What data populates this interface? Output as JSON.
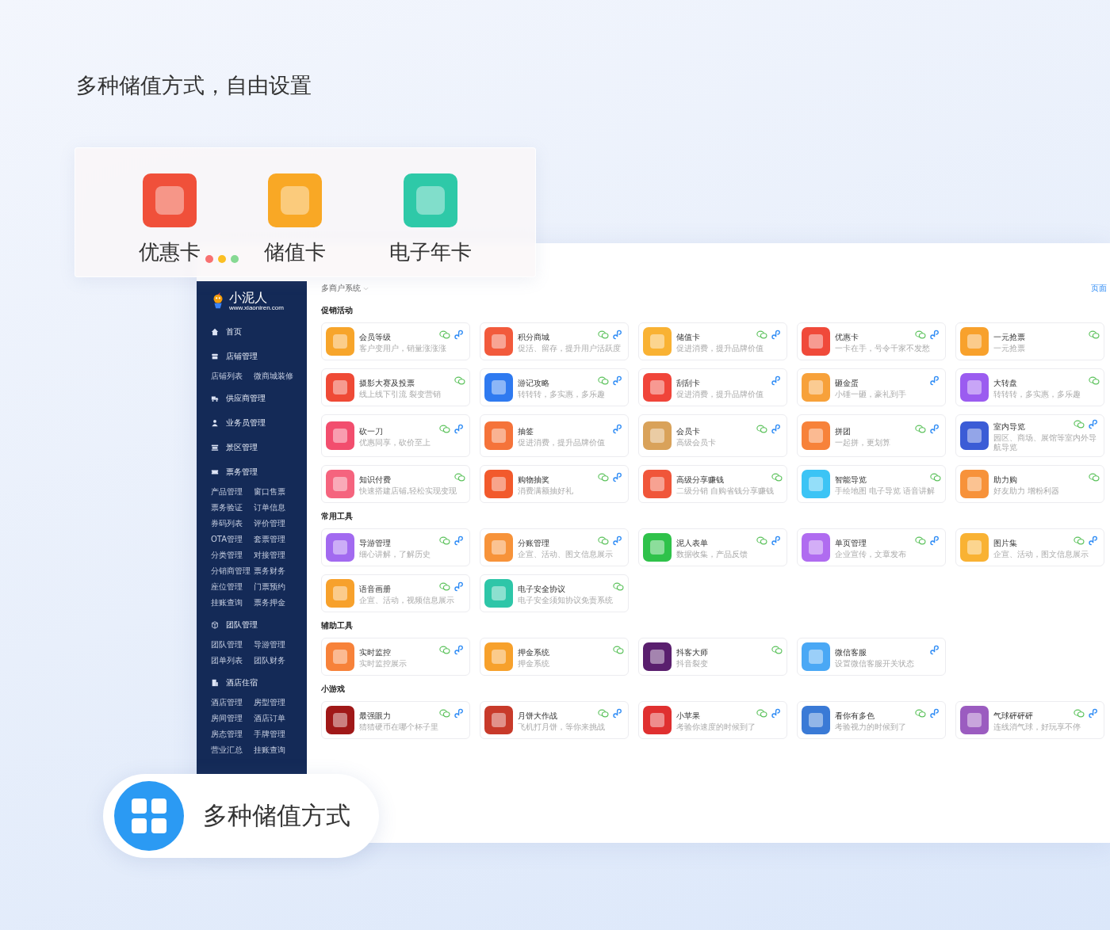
{
  "heading": "多种储值方式，自由设置",
  "feature_card": {
    "items": [
      {
        "label": "优惠卡",
        "color": "#f0503a"
      },
      {
        "label": "储值卡",
        "color": "#f9a825"
      },
      {
        "label": "电子年卡",
        "color": "#2ec9a8"
      }
    ]
  },
  "window": {
    "sidebar": {
      "logo": "小泥人",
      "logo_url": "www.xiaoniren.com",
      "items": [
        {
          "label": "首页"
        },
        {
          "label": "店铺管理",
          "children": [
            "店铺列表",
            "微商城装修"
          ]
        },
        {
          "label": "供应商管理"
        },
        {
          "label": "业务员管理"
        },
        {
          "label": "景区管理"
        },
        {
          "label": "票务管理",
          "children": [
            "产品管理",
            "窗口售票",
            "票务验证",
            "订单信息",
            "券码列表",
            "评价管理",
            "OTA管理",
            "套票管理",
            "分类管理",
            "对接管理",
            "分销商管理",
            "票务财务",
            "座位管理",
            "门票预约",
            "挂账查询",
            "票务押金"
          ]
        },
        {
          "label": "团队管理",
          "children": [
            "团队管理",
            "导游管理",
            "团单列表",
            "团队财务"
          ]
        },
        {
          "label": "酒店住宿",
          "children": [
            "酒店管理",
            "房型管理",
            "房间管理",
            "酒店订单",
            "房态管理",
            "手牌管理",
            "营业汇总",
            "挂账查询"
          ]
        }
      ]
    },
    "breadcrumb": "多商户系统",
    "top_link": "页面",
    "sections": [
      {
        "title": "促销活动",
        "items": [
          {
            "title": "会员等级",
            "desc": "客户变用户，销量涨涨涨",
            "wechat": true,
            "miniapp": true,
            "color": "#f7a52b"
          },
          {
            "title": "积分商城",
            "desc": "促活、留存，提升用户活跃度",
            "wechat": true,
            "miniapp": true,
            "color": "#f25a3c"
          },
          {
            "title": "储值卡",
            "desc": "促进消费，提升品牌价值",
            "wechat": true,
            "miniapp": true,
            "color": "#f9b233"
          },
          {
            "title": "优惠卡",
            "desc": "一卡在手，号令千家不发愁",
            "wechat": true,
            "miniapp": true,
            "color": "#f04a3a"
          },
          {
            "title": "一元抢票",
            "desc": "一元抢票",
            "wechat": true,
            "miniapp": false,
            "color": "#f8a12c"
          },
          {
            "title": "摄影大赛及投票",
            "desc": "线上线下引流 裂变营销",
            "wechat": true,
            "miniapp": false,
            "color": "#ef4a36"
          },
          {
            "title": "游记攻略",
            "desc": "转转转，多实惠，多乐趣",
            "wechat": true,
            "miniapp": true,
            "color": "#2f7af0"
          },
          {
            "title": "刮刮卡",
            "desc": "促进消费，提升品牌价值",
            "wechat": false,
            "miniapp": true,
            "color": "#f0453a"
          },
          {
            "title": "砸金蛋",
            "desc": "小锤一砸，豪礼到手",
            "wechat": false,
            "miniapp": true,
            "color": "#f7a13a"
          },
          {
            "title": "大转盘",
            "desc": "转转转，多实惠，多乐趣",
            "wechat": true,
            "miniapp": false,
            "color": "#9b5cf0"
          },
          {
            "title": "砍一刀",
            "desc": "优惠同享，砍价至上",
            "wechat": true,
            "miniapp": true,
            "color": "#f24e6e"
          },
          {
            "title": "抽签",
            "desc": "促进消费，提升品牌价值",
            "wechat": false,
            "miniapp": true,
            "color": "#f5733a"
          },
          {
            "title": "会员卡",
            "desc": "高级会员卡",
            "wechat": true,
            "miniapp": true,
            "color": "#d9a25a"
          },
          {
            "title": "拼团",
            "desc": "一起拼，更划算",
            "wechat": true,
            "miniapp": true,
            "color": "#f7823a"
          },
          {
            "title": "室内导览",
            "desc": "园区、商场、展馆等室内外导航导览",
            "wechat": true,
            "miniapp": true,
            "color": "#3b5cd6"
          },
          {
            "title": "知识付费",
            "desc": "快速搭建店铺,轻松实现变现",
            "wechat": true,
            "miniapp": false,
            "color": "#f5647e"
          },
          {
            "title": "购物抽奖",
            "desc": "消费满额抽好礼",
            "wechat": true,
            "miniapp": true,
            "color": "#f25a2c"
          },
          {
            "title": "高级分享赚钱",
            "desc": "二级分销 自购省钱分享赚钱",
            "wechat": true,
            "miniapp": false,
            "color": "#f0563a"
          },
          {
            "title": "智能导览",
            "desc": "手绘地图 电子导览 语音讲解",
            "wechat": true,
            "miniapp": false,
            "color": "#3cc4f5"
          },
          {
            "title": "助力购",
            "desc": "好友助力 增粉利器",
            "wechat": true,
            "miniapp": false,
            "color": "#f7923a"
          }
        ]
      },
      {
        "title": "常用工具",
        "items": [
          {
            "title": "导游管理",
            "desc": "细心讲解，了解历史",
            "wechat": true,
            "miniapp": true,
            "color": "#a26af0"
          },
          {
            "title": "分账管理",
            "desc": "企宣、活动、图文信息展示",
            "wechat": true,
            "miniapp": true,
            "color": "#f7933a"
          },
          {
            "title": "泥人表单",
            "desc": "数据收集，产品反馈",
            "wechat": true,
            "miniapp": true,
            "color": "#2fc24a"
          },
          {
            "title": "单页管理",
            "desc": "企业宣传，文章发布",
            "wechat": true,
            "miniapp": true,
            "color": "#b06cf0"
          },
          {
            "title": "图片集",
            "desc": "企宣、活动，图文信息展示",
            "wechat": true,
            "miniapp": true,
            "color": "#f9b233"
          },
          {
            "title": "语音画册",
            "desc": "企宣、活动，视频信息展示",
            "wechat": true,
            "miniapp": true,
            "color": "#f7a12c"
          },
          {
            "title": "电子安全协议",
            "desc": "电子安全须知协议免责系统",
            "wechat": true,
            "miniapp": false,
            "color": "#2ec6a8"
          }
        ]
      },
      {
        "title": "辅助工具",
        "items": [
          {
            "title": "实时监控",
            "desc": "实时监控展示",
            "wechat": true,
            "miniapp": true,
            "color": "#f7823a"
          },
          {
            "title": "押金系统",
            "desc": "押金系统",
            "wechat": true,
            "miniapp": false,
            "color": "#f7a12c"
          },
          {
            "title": "抖客大师",
            "desc": "抖音裂变",
            "wechat": true,
            "miniapp": false,
            "color": "#5a1f6e"
          },
          {
            "title": "微信客服",
            "desc": "设置微信客服开关状态",
            "wechat": false,
            "miniapp": true,
            "color": "#4aa8f5"
          }
        ]
      },
      {
        "title": "小游戏",
        "items": [
          {
            "title": "最强眼力",
            "desc": "猜猜硬币在哪个杯子里",
            "wechat": true,
            "miniapp": true,
            "color": "#a01818"
          },
          {
            "title": "月饼大作战",
            "desc": "飞机打月饼，等你来挑战",
            "wechat": true,
            "miniapp": true,
            "color": "#c83a2a"
          },
          {
            "title": "小苹果",
            "desc": "考验你速度的时候到了",
            "wechat": true,
            "miniapp": true,
            "color": "#e03030"
          },
          {
            "title": "看你有多色",
            "desc": "考验视力的时候到了",
            "wechat": true,
            "miniapp": true,
            "color": "#3a7ad6"
          },
          {
            "title": "气球砰砰砰",
            "desc": "连线消气球，好玩享不停",
            "wechat": true,
            "miniapp": true,
            "color": "#9b5cc0"
          }
        ]
      }
    ]
  },
  "badge": {
    "label": "多种储值方式"
  }
}
